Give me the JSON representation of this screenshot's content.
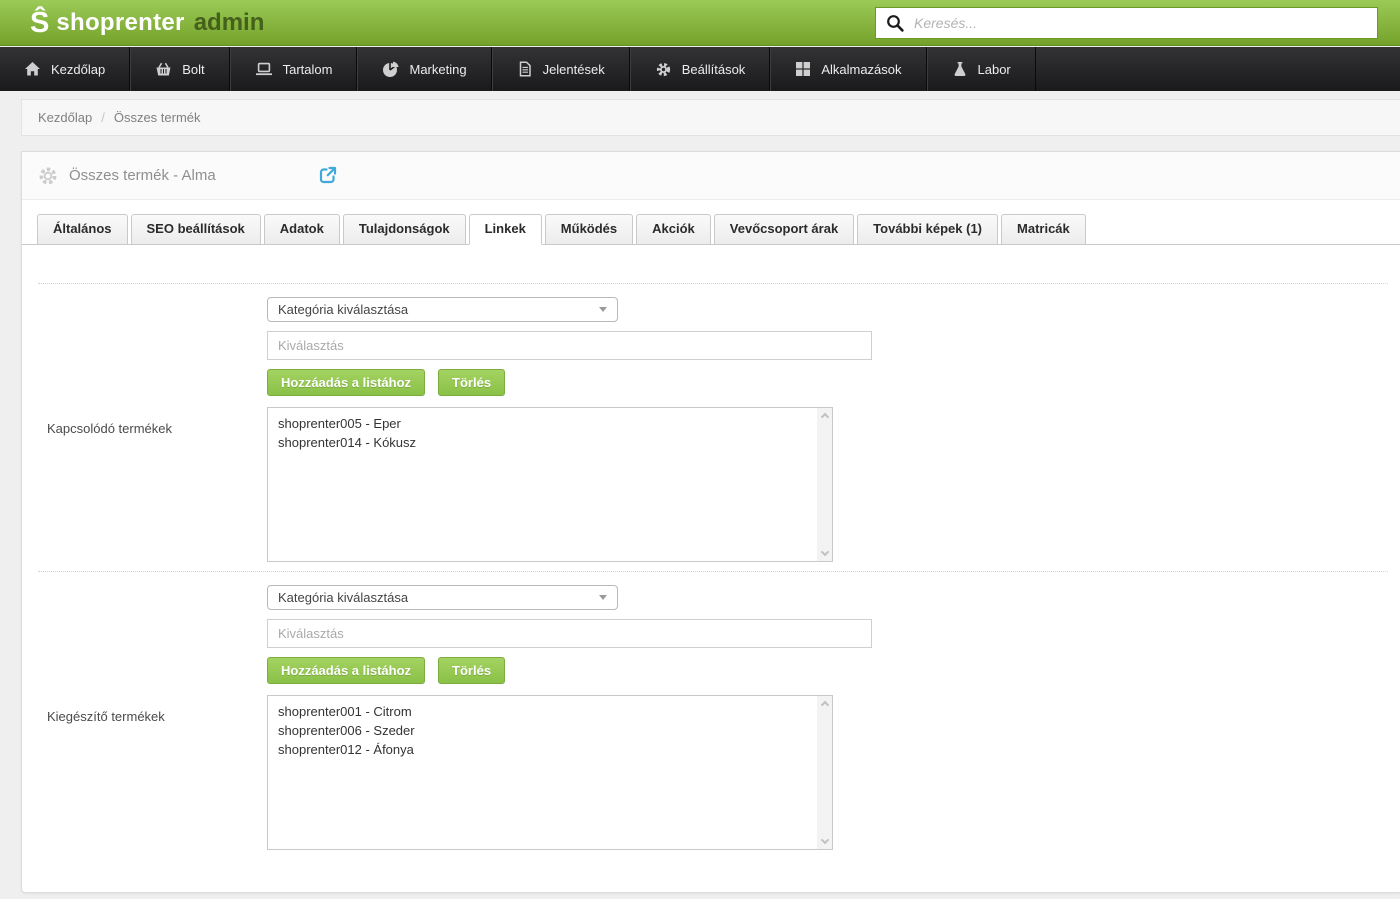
{
  "header": {
    "logo_glyph": "Ŝ",
    "logo_name": "shoprenter",
    "logo_suffix": "admin",
    "search": {
      "placeholder": "Keresés..."
    }
  },
  "nav": {
    "items": [
      {
        "label": "Kezdőlap",
        "icon": "home-icon"
      },
      {
        "label": "Bolt",
        "icon": "basket-icon"
      },
      {
        "label": "Tartalom",
        "icon": "laptop-icon"
      },
      {
        "label": "Marketing",
        "icon": "pie-chart-icon"
      },
      {
        "label": "Jelentések",
        "icon": "document-icon"
      },
      {
        "label": "Beállítások",
        "icon": "gear-icon"
      },
      {
        "label": "Alkalmazások",
        "icon": "grid-icon"
      },
      {
        "label": "Labor",
        "icon": "flask-icon"
      }
    ]
  },
  "breadcrumb": {
    "home": "Kezdőlap",
    "separator": "/",
    "current": "Összes termék"
  },
  "page": {
    "title": "Összes termék - Alma"
  },
  "tabs": [
    {
      "label": "Általános",
      "active": false
    },
    {
      "label": "SEO beállítások",
      "active": false
    },
    {
      "label": "Adatok",
      "active": false
    },
    {
      "label": "Tulajdonságok",
      "active": false
    },
    {
      "label": "Linkek",
      "active": true
    },
    {
      "label": "Működés",
      "active": false
    },
    {
      "label": "Akciók",
      "active": false
    },
    {
      "label": "Vevőcsoport árak",
      "active": false
    },
    {
      "label": "További képek (1)",
      "active": false
    },
    {
      "label": "Matricák",
      "active": false
    }
  ],
  "form": {
    "rows": [
      {
        "label": "Kapcsolódó termékek",
        "select_value": "Kategória kiválasztása",
        "input_placeholder": "Kiválasztás",
        "add_button": "Hozzáadás a listához",
        "delete_button": "Törlés",
        "items": [
          "shoprenter005 - Eper",
          "shoprenter014 - Kókusz"
        ]
      },
      {
        "label": "Kiegészítő termékek",
        "select_value": "Kategória kiválasztása",
        "input_placeholder": "Kiválasztás",
        "add_button": "Hozzáadás a listához",
        "delete_button": "Törlés",
        "items": [
          "shoprenter001 - Citrom",
          "shoprenter006 - Szeder",
          "shoprenter012 - Áfonya"
        ]
      }
    ]
  },
  "colors": {
    "header_green_top": "#9cca58",
    "header_green_bottom": "#74a22a",
    "nav_bg": "#1e1e20",
    "button_green": "#8bc148",
    "link_blue": "#40a9da"
  }
}
